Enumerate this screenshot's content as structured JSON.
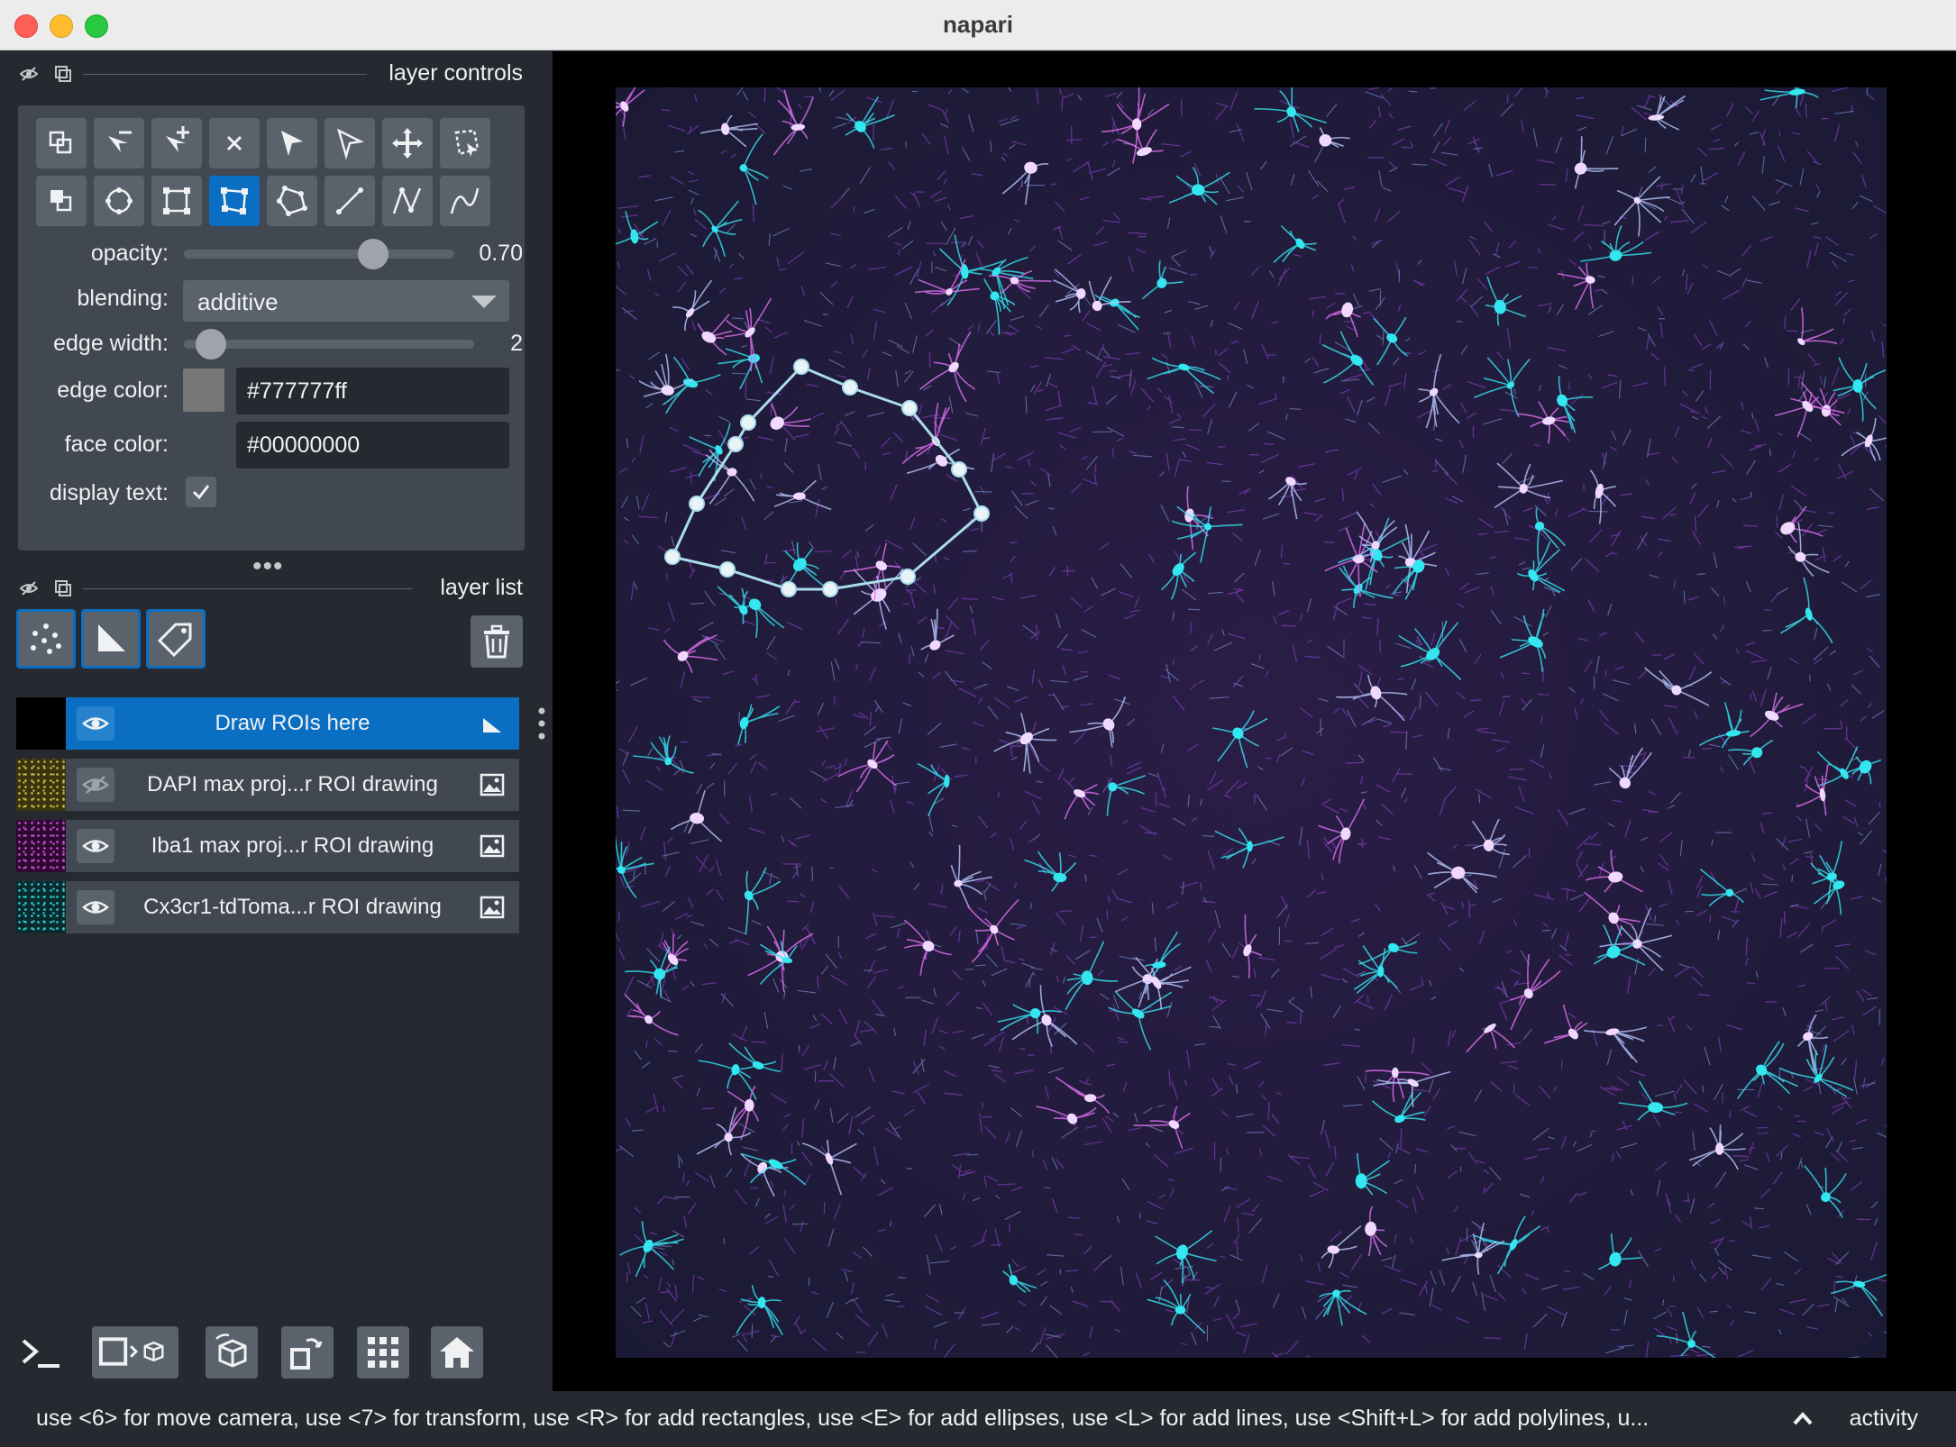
{
  "window": {
    "title": "napari"
  },
  "layer_controls": {
    "title": "layer controls",
    "tools": [
      [
        "copy-icon",
        "remove-point-icon",
        "add-point-icon",
        "delete-icon",
        "select-icon",
        "direct-select-icon",
        "pan-zoom-icon",
        "lasso-select-icon"
      ],
      [
        "bring-to-front-icon",
        "ellipse-icon",
        "rectangle-icon",
        "polygon-icon",
        "lasso-polygon-icon",
        "line-icon",
        "path-icon",
        "polyline-icon"
      ]
    ],
    "active_tool": "polygon-icon",
    "opacity": {
      "label": "opacity:",
      "value": 0.7,
      "display": "0.70"
    },
    "blending": {
      "label": "blending:",
      "value": "additive"
    },
    "edge_width": {
      "label": "edge width:",
      "value": 2,
      "max": 40,
      "display": "2"
    },
    "edge_color": {
      "label": "edge color:",
      "value": "#777777ff",
      "swatch": "#777777"
    },
    "face_color": {
      "label": "face color:",
      "value": "#00000000"
    },
    "display_text": {
      "label": "display text:",
      "checked": true
    }
  },
  "layer_list": {
    "title": "layer list",
    "new_layer_buttons": [
      "new-points-icon",
      "new-shapes-icon",
      "new-labels-icon"
    ],
    "layers": [
      {
        "name": "Draw ROIs here",
        "visible": true,
        "selected": true,
        "type": "shapes",
        "thumb": "#000000"
      },
      {
        "name": "DAPI max proj...r ROI drawing",
        "visible": false,
        "selected": false,
        "type": "image",
        "thumb": "#3a3410"
      },
      {
        "name": "Iba1 max proj...r ROI drawing",
        "visible": true,
        "selected": false,
        "type": "image",
        "thumb": "#2e0a30"
      },
      {
        "name": "Cx3cr1-tdToma...r ROI drawing",
        "visible": true,
        "selected": false,
        "type": "image",
        "thumb": "#0a2a2e"
      }
    ]
  },
  "bottom_toolbar": [
    "console-icon",
    "ndisplay-toggle-icon",
    "roll-dims-icon",
    "transpose-dims-icon",
    "grid-view-icon",
    "home-icon"
  ],
  "status_bar": {
    "text": "use <6> for move camera, use <7> for transform, use <R> for add rectangles, use <E> for add ellipses, use <L> for add lines, use <Shift+L> for add polylines, u...",
    "activity_label": "activity"
  },
  "colors": {
    "background": "#262930",
    "panel": "#414851",
    "control": "#5a626c",
    "accent": "#0a6fc2",
    "roi_stroke": "#a9ddea",
    "cyan": "#33e6f0",
    "magenta": "#c040e0"
  }
}
